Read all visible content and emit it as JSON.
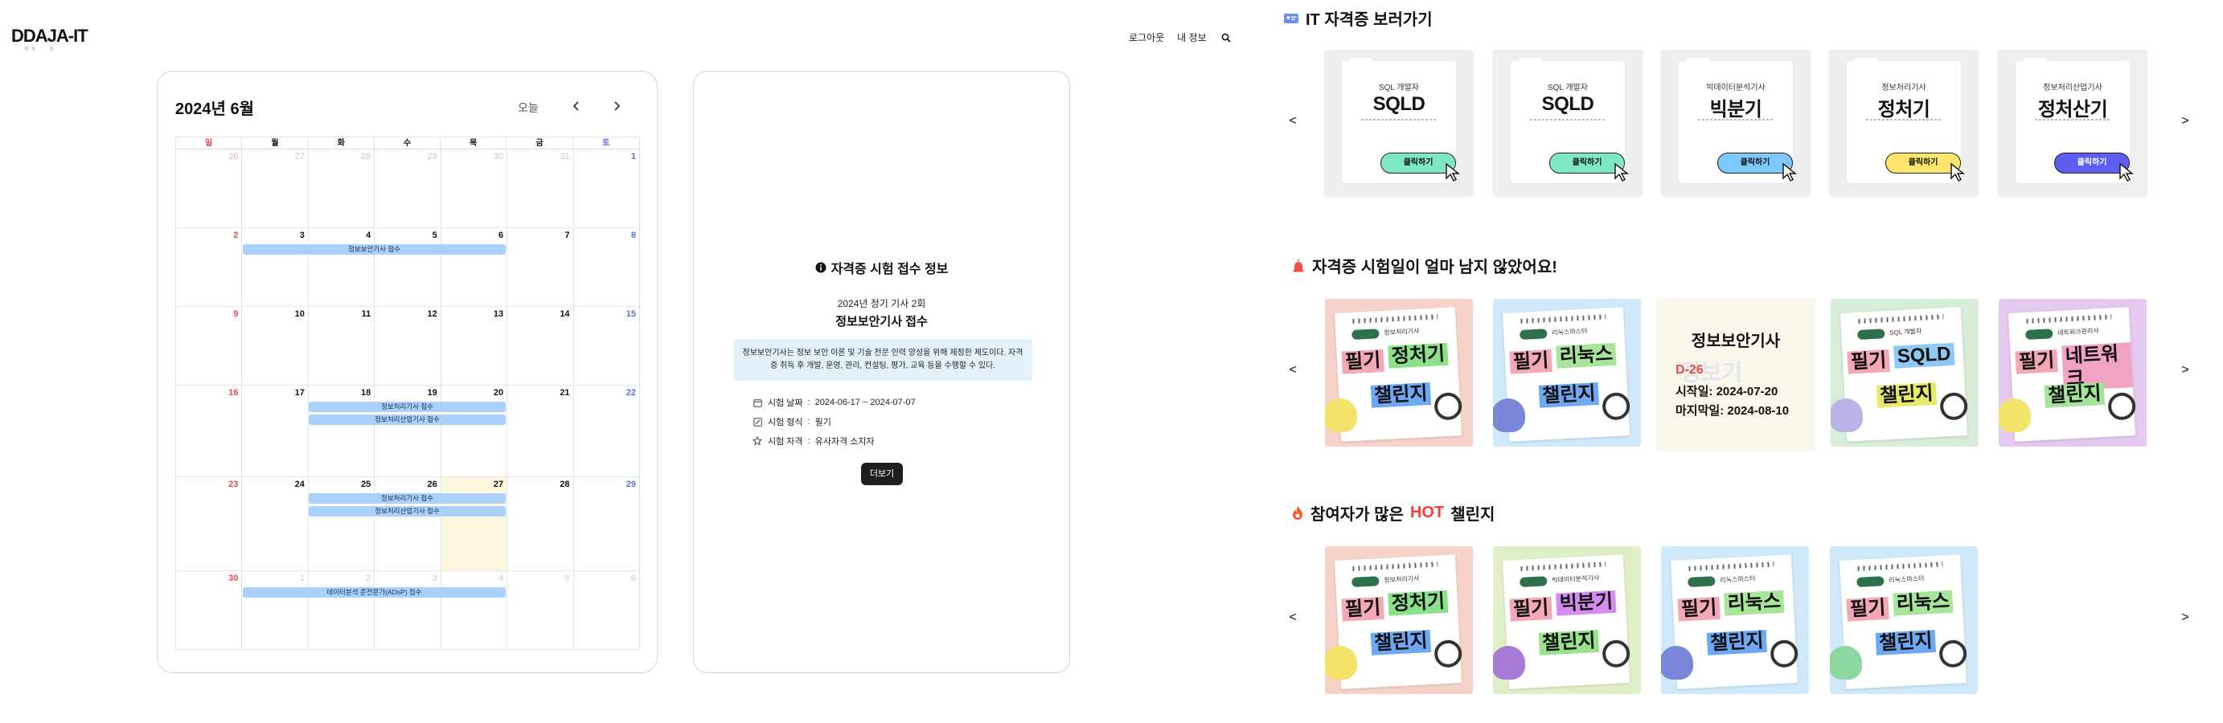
{
  "header": {
    "logo": "DDAJA-IT",
    "logo_sub": "따자 · 잇",
    "nav": [
      "로그아웃",
      "내 정보"
    ]
  },
  "calendar": {
    "title": "2024년 6월",
    "today_label": "오늘",
    "weekdays": [
      "일",
      "월",
      "화",
      "수",
      "목",
      "금",
      "토"
    ],
    "weeks": [
      [
        "26",
        "27",
        "28",
        "29",
        "30",
        "31",
        "1"
      ],
      [
        "2",
        "3",
        "4",
        "5",
        "6",
        "7",
        "8"
      ],
      [
        "9",
        "10",
        "11",
        "12",
        "13",
        "14",
        "15"
      ],
      [
        "16",
        "17",
        "18",
        "19",
        "20",
        "21",
        "22"
      ],
      [
        "23",
        "24",
        "25",
        "26",
        "27",
        "28",
        "29"
      ],
      [
        "30",
        "1",
        "2",
        "3",
        "4",
        "5",
        "6"
      ]
    ],
    "events": [
      "정보보안기사 접수",
      "정보처리기사 접수",
      "정보처리산업기사 접수",
      "정보처리기사 접수",
      "정보처리산업기사 접수",
      "데이터분석 준전문가(ADsP) 접수"
    ]
  },
  "info": {
    "heading": "자격증 시험 접수 정보",
    "round": "2024년 정기 기사 2회",
    "name": "정보보안기사 접수",
    "description": "정보보안기사는 정보 보안 이론 및 기술 전문 인력 양성을 위해 제정한 제도이다. 자격증 취득 후 개발, 운영, 관리, 컨설팅, 평가, 교육 등을 수행할 수 있다.",
    "date_label": "시험 날짜",
    "date_value": "2024-06-17 ~ 2024-07-07",
    "type_label": "시험 형식",
    "type_value": "필기",
    "qual_label": "시험 자격",
    "qual_value": "유사자격 소지자",
    "more_button": "더보기"
  },
  "sections": {
    "certs_title": "IT 자격증 보러가기",
    "exam_title": "자격증 시험일이 얼마 남지 않았어요!",
    "hot_prefix": "참여자가 많은",
    "hot_word": "HOT",
    "hot_suffix": "챌린지"
  },
  "cert_cards": [
    {
      "sub": "SQL 개발자",
      "name": "SQLD",
      "button": "클릭하기",
      "color": "#7ee8c4"
    },
    {
      "sub": "SQL 개발자",
      "name": "SQLD",
      "button": "클릭하기",
      "color": "#7ee8c4"
    },
    {
      "sub": "빅데이터분석기사",
      "name": "빅분기",
      "button": "클릭하기",
      "color": "#7cc8ff"
    },
    {
      "sub": "정보처리기사",
      "name": "정처기",
      "button": "클릭하기",
      "color": "#ffe56b"
    },
    {
      "sub": "정보처리산업기사",
      "name": "정처산기",
      "button": "클릭하기",
      "color": "#5b5ef0"
    }
  ],
  "exam_cards": [
    {
      "topic": "정보처리기사",
      "word1": "필기",
      "word2": "정처기",
      "word3": "챌린지",
      "bg": "#f6d2c8",
      "w2bg": "#8de08a",
      "w3bg": "#6fa8f2",
      "mascot": "#f3e36b"
    },
    {
      "topic": "리눅스마스터",
      "word1": "필기",
      "word2": "리눅스",
      "word3": "챌린지",
      "bg": "#cfe9fa",
      "w2bg": "#a8e49a",
      "w3bg": "#6fa8f2",
      "mascot": "#7a86d8"
    },
    {
      "topic": "SQL 개발자",
      "word1": "필기",
      "word2": "SQLD",
      "word3": "챌린지",
      "bg": "#d7ecd9",
      "w2bg": "#8ec9f5",
      "w3bg": "#e6e96a",
      "mascot": "#b9b3e6"
    },
    {
      "topic": "네트워크관리사",
      "word1": "필기",
      "word2": "네트워크",
      "word3": "챌린지",
      "bg": "#e3c9ee",
      "w2bg": "#f2a3c4",
      "w3bg": "#a3e39a",
      "mascot": "#f3e36b"
    }
  ],
  "dday": {
    "title": "정보보안기사",
    "dday": "D-26",
    "start": "시작일: 2024-07-20",
    "end": "마지막일: 2024-08-10",
    "faded": "정보기"
  },
  "hot_cards": [
    {
      "topic": "정보처리기사",
      "word1": "필기",
      "word2": "정처기",
      "word3": "챌린지",
      "bg": "#f6d2c8",
      "w2bg": "#8de08a",
      "w3bg": "#6fa8f2",
      "mascot": "#f3e36b"
    },
    {
      "topic": "빅데이터분석기사",
      "word1": "필기",
      "word2": "빅분기",
      "word3": "챌린지",
      "bg": "#e1efc9",
      "w2bg": "#d58cf0",
      "w3bg": "#9be08a",
      "mascot": "#a77ad8"
    },
    {
      "topic": "리눅스마스터",
      "word1": "필기",
      "word2": "리눅스",
      "word3": "챌린지",
      "bg": "#cfe9fa",
      "w2bg": "#a8e49a",
      "w3bg": "#6fa8f2",
      "mascot": "#7a86d8"
    },
    {
      "topic": "리눅스마스터",
      "word1": "필기",
      "word2": "리눅스",
      "word3": "챌린지",
      "bg": "#cfe9fa",
      "w2bg": "#a8e49a",
      "w3bg": "#6fa8f2",
      "mascot": "#8cd8a0"
    }
  ],
  "colors": {
    "event": "#a9d1fb",
    "today": "#fdf7dd",
    "sunday": "#e5484d",
    "saturday": "#5b6ee1",
    "hot": "#ff3b3b"
  },
  "icons": {
    "search": "search-icon",
    "prev": "chevron-left-icon",
    "next": "chevron-right-icon",
    "info": "info-circle-icon",
    "calendar": "calendar-icon",
    "edit": "edit-icon",
    "badge": "badge-icon",
    "certs_section": "id-card-icon",
    "exam_section": "alarm-icon",
    "hot_section": "fire-icon"
  }
}
